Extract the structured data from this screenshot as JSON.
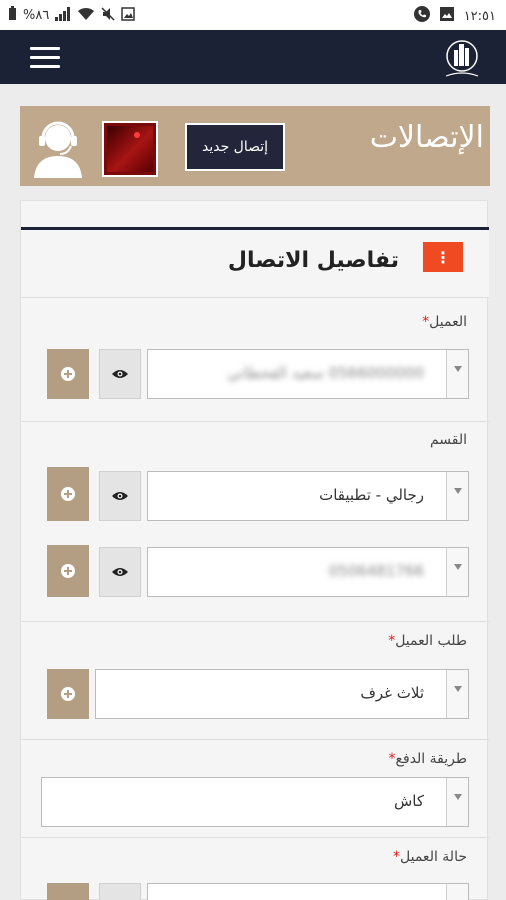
{
  "status_bar": {
    "time": "١٢:٥١",
    "battery": "%٨٦"
  },
  "banner": {
    "title": "الإتصالات",
    "new_call_label": "إتصال جديد"
  },
  "card": {
    "title": "تفاصيل الاتصال",
    "kebab_symbol": "⋮"
  },
  "fields": {
    "customer_label": "العميل",
    "customer_value": "0566000000 سعيد القحطاني",
    "department_label": "القسم",
    "department_value": "رجالي - تطبيقات",
    "phone_value": "0506481766",
    "request_label": "طلب العميل",
    "request_value": "ثلاث غرف",
    "payment_label": "طريقة الدفع",
    "payment_value": "كاش",
    "status_label": "حالة العميل",
    "required_mark": "*"
  },
  "colors": {
    "navbar": "#1c2235",
    "banner": "#bfa88c",
    "kebab": "#f04a23",
    "plus_button": "#b39e83",
    "required": "#e21c1c"
  },
  "icons": {
    "menu": "hamburger-icon",
    "eye": "eye-icon",
    "plus": "plus-icon",
    "agent": "headset-agent-icon"
  }
}
